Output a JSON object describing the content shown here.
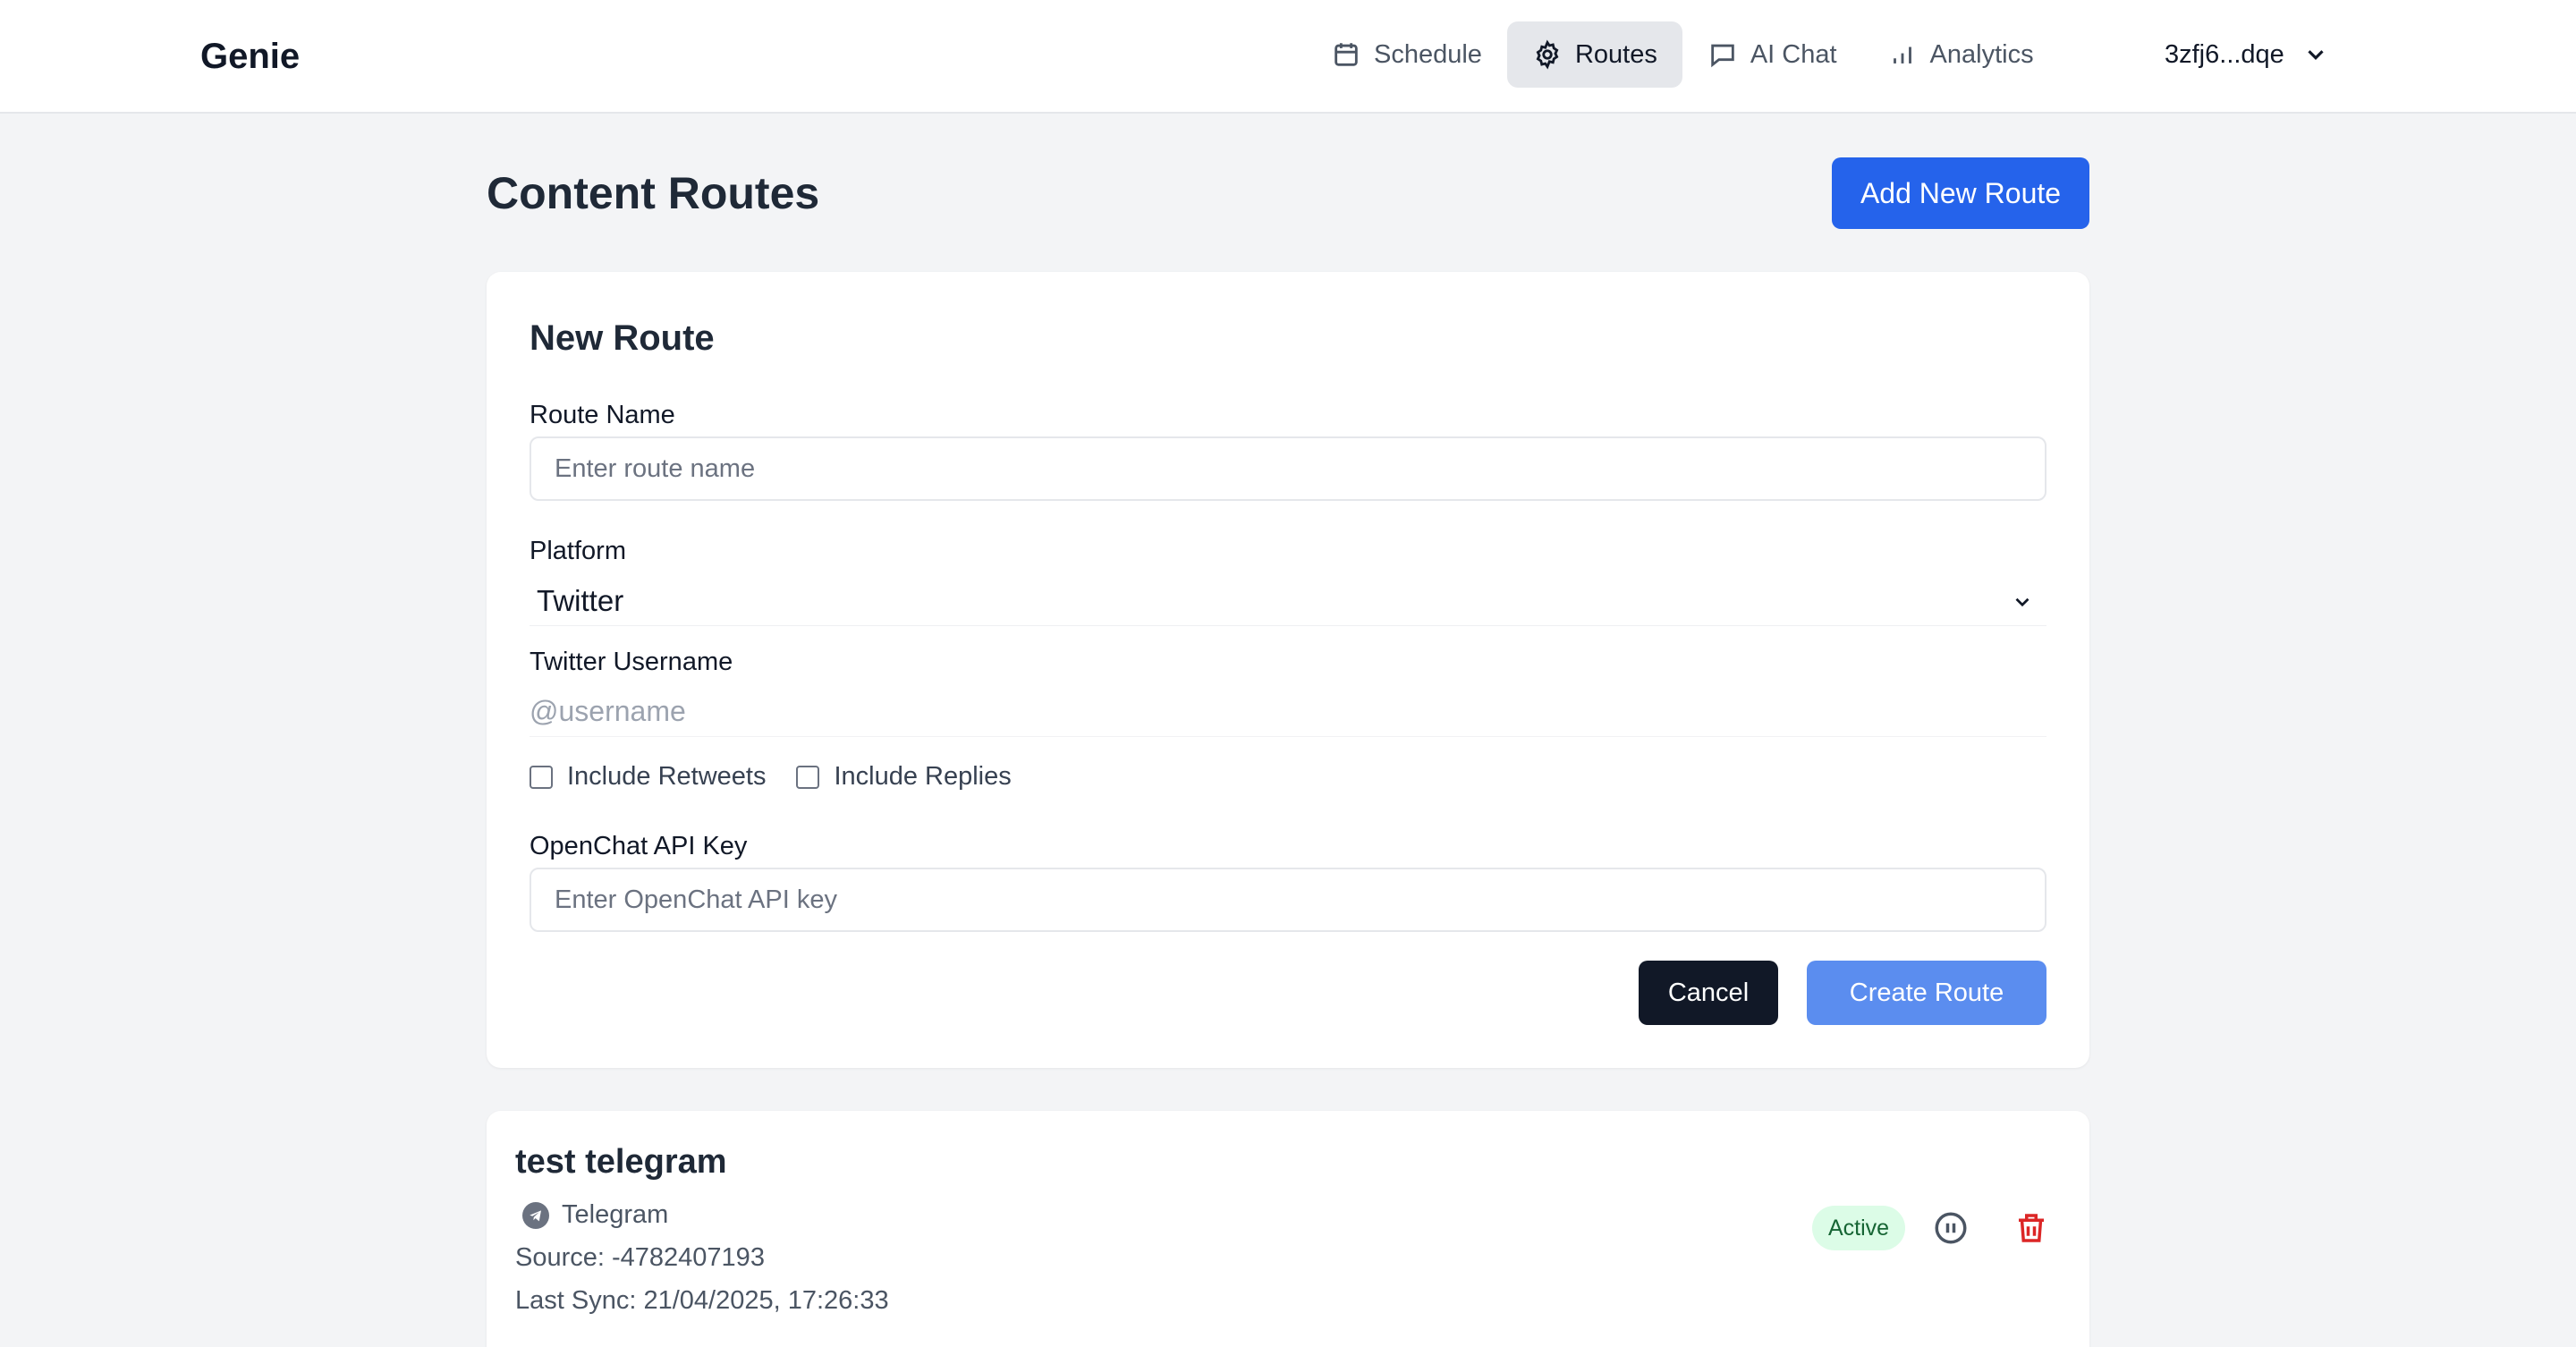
{
  "header": {
    "brand": "Genie",
    "nav": [
      {
        "label": "Schedule",
        "icon": "calendar-icon",
        "active": false
      },
      {
        "label": "Routes",
        "icon": "gear-icon",
        "active": true
      },
      {
        "label": "AI Chat",
        "icon": "chat-icon",
        "active": false
      },
      {
        "label": "Analytics",
        "icon": "bar-chart-icon",
        "active": false
      }
    ],
    "user": "3zfj6...dqe"
  },
  "page": {
    "title": "Content Routes",
    "add_button": "Add New Route"
  },
  "form": {
    "title": "New Route",
    "route_name_label": "Route Name",
    "route_name_placeholder": "Enter route name",
    "route_name_value": "",
    "platform_label": "Platform",
    "platform_value": "Twitter",
    "username_label": "Twitter Username",
    "username_placeholder": "@username",
    "include_retweets": "Include Retweets",
    "include_replies": "Include Replies",
    "api_key_label": "OpenChat API Key",
    "api_key_placeholder": "Enter OpenChat API key",
    "cancel": "Cancel",
    "create": "Create Route"
  },
  "routes": [
    {
      "name": "test telegram",
      "platform": "Telegram",
      "source": "Source: -4782407193",
      "last_sync": "Last Sync: 21/04/2025, 17:26:33",
      "status": "Active"
    }
  ],
  "colors": {
    "primary": "#2563eb",
    "create_button": "#5b8def",
    "active_badge_bg": "#dcfce7",
    "active_badge_text": "#166534",
    "delete": "#dc2626"
  }
}
